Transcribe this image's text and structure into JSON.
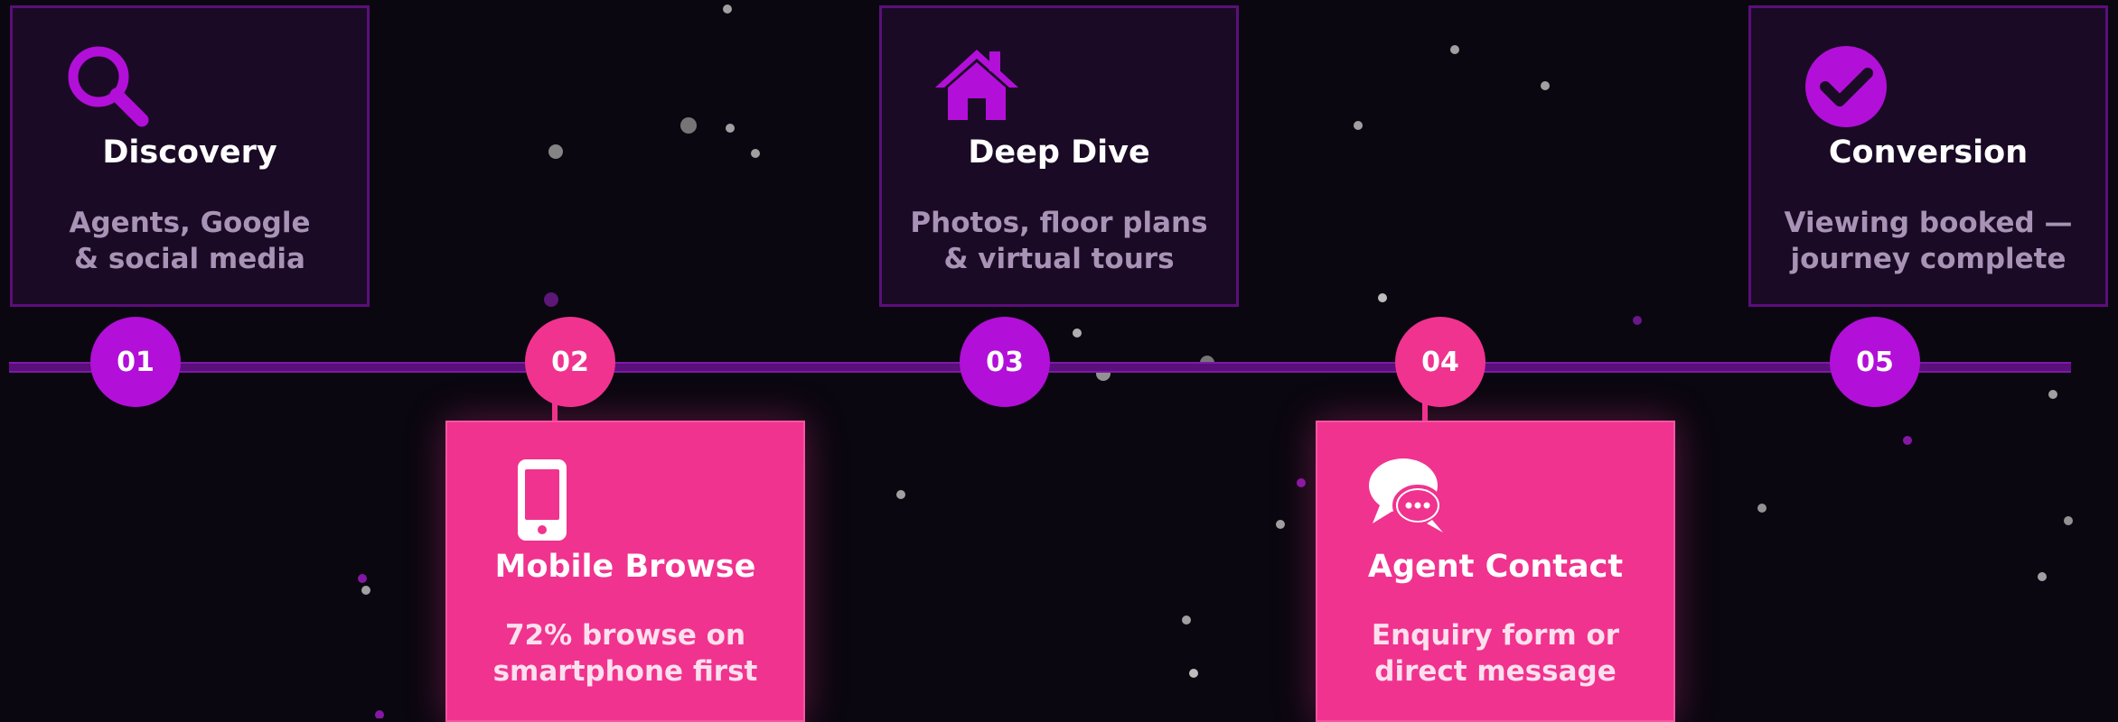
{
  "colors": {
    "background": "#0a0710",
    "purple_accent": "#b20fd8",
    "pink_accent": "#f0338e",
    "dark_card": "#1a0a25",
    "card_border": "#5b0f7a"
  },
  "steps": [
    {
      "number": "01",
      "title": "Discovery",
      "desc_line1": "Agents, Google",
      "desc_line2": "& social media",
      "icon": "search-icon"
    },
    {
      "number": "02",
      "title": "Mobile Browse",
      "desc_line1": "72% browse on",
      "desc_line2": "smartphone first",
      "icon": "smartphone-icon"
    },
    {
      "number": "03",
      "title": "Deep Dive",
      "desc_line1": "Photos, floor plans",
      "desc_line2": "& virtual tours",
      "icon": "home-icon"
    },
    {
      "number": "04",
      "title": "Agent Contact",
      "desc_line1": "Enquiry form or",
      "desc_line2": "direct message",
      "icon": "chat-bubbles-icon"
    },
    {
      "number": "05",
      "title": "Conversion",
      "desc_line1": "Viewing booked —",
      "desc_line2": "journey complete",
      "icon": "check-circle-icon"
    }
  ]
}
